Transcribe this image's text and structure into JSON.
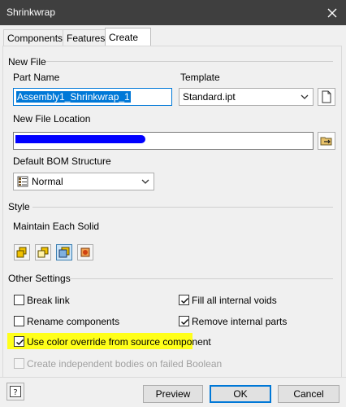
{
  "window": {
    "title": "Shrinkwrap"
  },
  "tabs": [
    {
      "label": "Components"
    },
    {
      "label": "Features"
    },
    {
      "label": "Create"
    }
  ],
  "new_file": {
    "heading": "New File",
    "part_name_label": "Part Name",
    "part_name_value": "Assembly1_Shrinkwrap_1",
    "template_label": "Template",
    "template_value": "Standard.ipt",
    "location_label": "New File Location",
    "location_value": "",
    "bom_label": "Default BOM Structure",
    "bom_value": "Normal"
  },
  "style": {
    "heading": "Style",
    "subheading": "Maintain Each Solid"
  },
  "other": {
    "heading": "Other Settings",
    "break_link": "Break link",
    "fill_voids": "Fill all internal voids",
    "rename_components": "Rename components",
    "remove_parts": "Remove internal parts",
    "color_override": "Use color override from source component",
    "independent_bodies": "Create independent bodies on failed Boolean"
  },
  "buttons": {
    "preview": "Preview",
    "ok": "OK",
    "cancel": "Cancel"
  },
  "colors": {
    "titlebar": "#3f3f3f",
    "highlight": "#ffff1a",
    "selection": "#0078d7",
    "redaction": "#0000ff"
  }
}
